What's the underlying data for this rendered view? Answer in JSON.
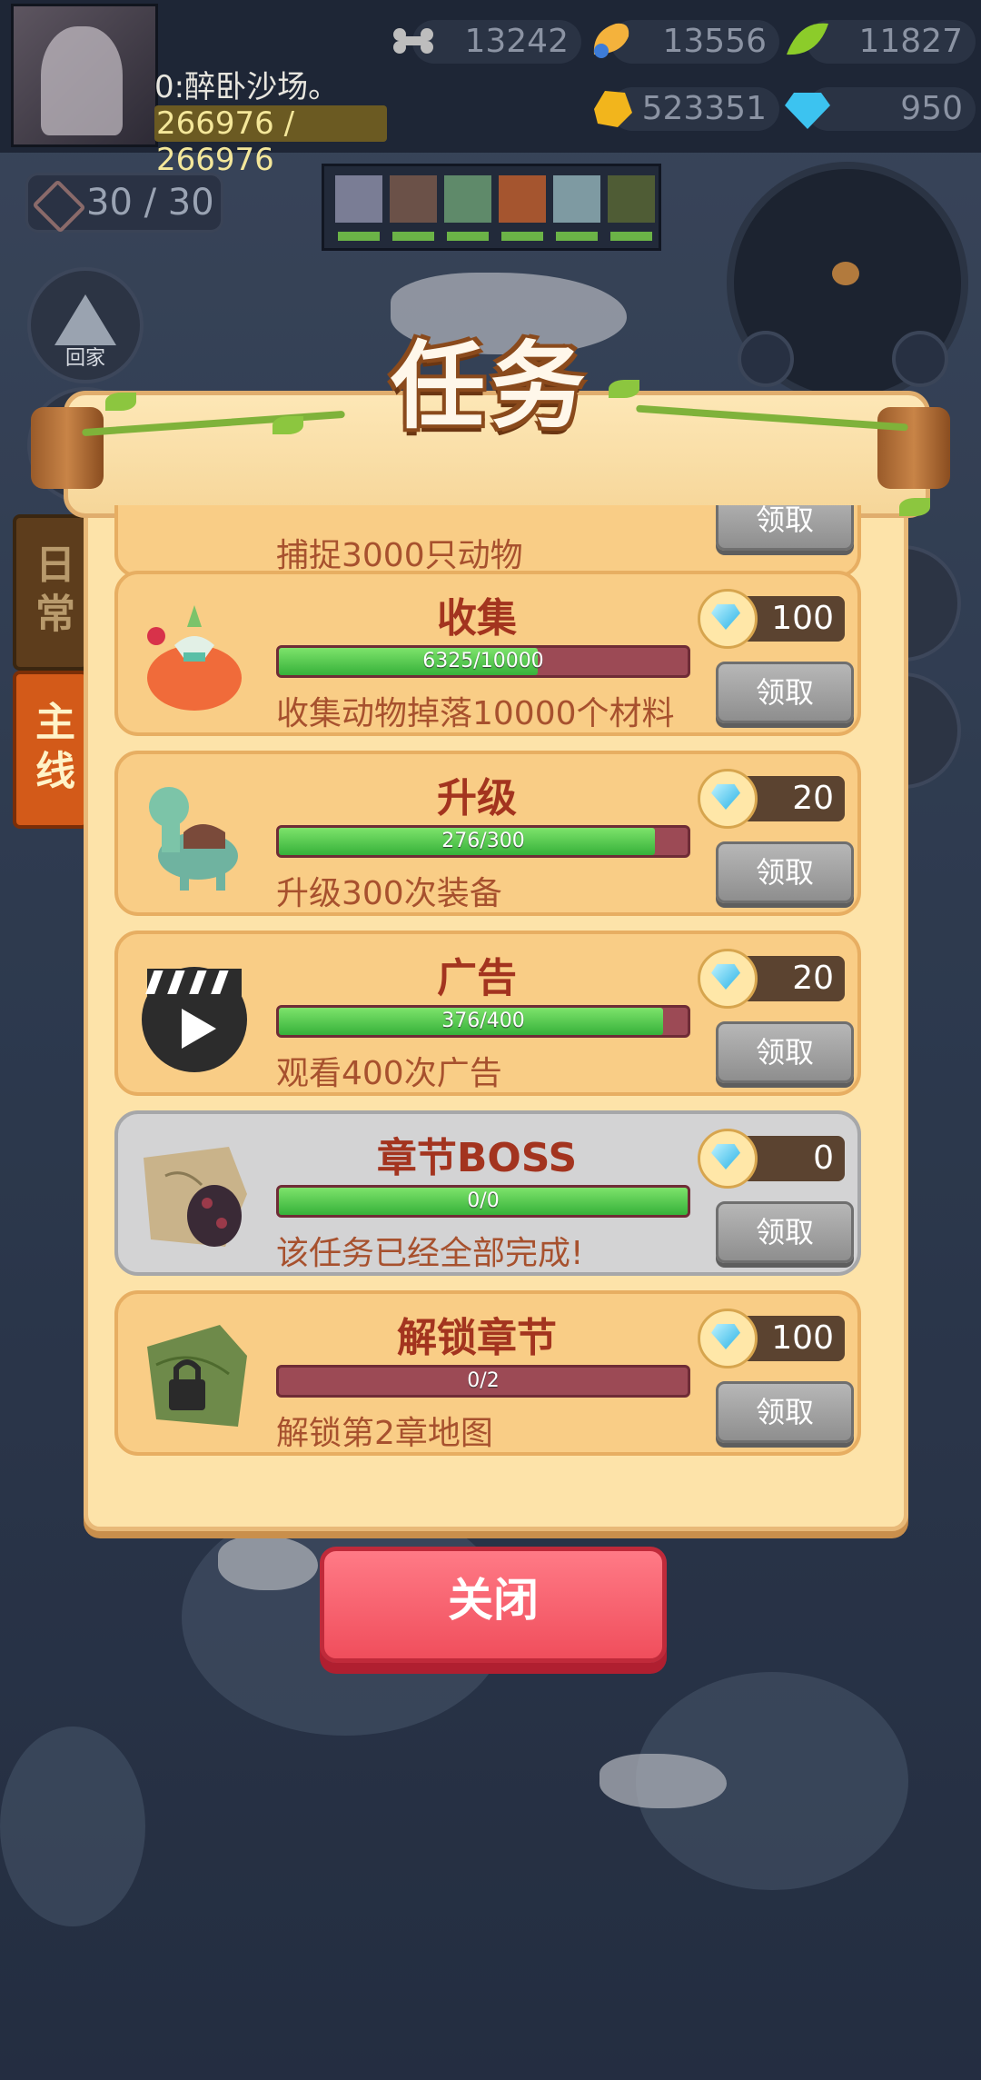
{
  "hud": {
    "player_name": "0:醉卧沙场。",
    "hp": "266976 / 266976",
    "resources": [
      {
        "icon": "bone-icon",
        "value": "13242"
      },
      {
        "icon": "meat-icon",
        "value": "13556"
      },
      {
        "icon": "leaf-icon",
        "value": "11827"
      },
      {
        "icon": "gold-ore-icon",
        "value": "523351"
      },
      {
        "icon": "diamond-icon",
        "value": "950"
      }
    ],
    "energy": "30 / 30",
    "home_label": "回家"
  },
  "side_tabs": {
    "daily": "日常",
    "main": "主线"
  },
  "panel": {
    "title": "任务",
    "partial_task_desc": "捕捉3000只动物",
    "partial_claim": "领取",
    "tasks": [
      {
        "title": "收集",
        "progress": "6325/10000",
        "progress_value": 0.6325,
        "desc": "收集动物掉落10000个材料",
        "reward": "100",
        "claim": "领取",
        "icon": "loot-bag-icon"
      },
      {
        "title": "升级",
        "progress": "276/300",
        "progress_value": 0.92,
        "desc": "升级300次装备",
        "reward": "20",
        "claim": "领取",
        "icon": "dinosaur-icon"
      },
      {
        "title": "广告",
        "progress": "376/400",
        "progress_value": 0.94,
        "desc": "观看400次广告",
        "reward": "20",
        "claim": "领取",
        "icon": "video-play-icon"
      },
      {
        "title": "章节BOSS",
        "progress": "0/0",
        "progress_value": 1.0,
        "desc": "该任务已经全部完成!",
        "reward": "0",
        "claim": "领取",
        "icon": "boss-map-icon",
        "done": true
      },
      {
        "title": "解锁章节",
        "progress": "0/2",
        "progress_value": 0.0,
        "desc": "解锁第2章地图",
        "reward": "100",
        "claim": "领取",
        "icon": "locked-map-icon"
      }
    ],
    "close_label": "关闭"
  }
}
